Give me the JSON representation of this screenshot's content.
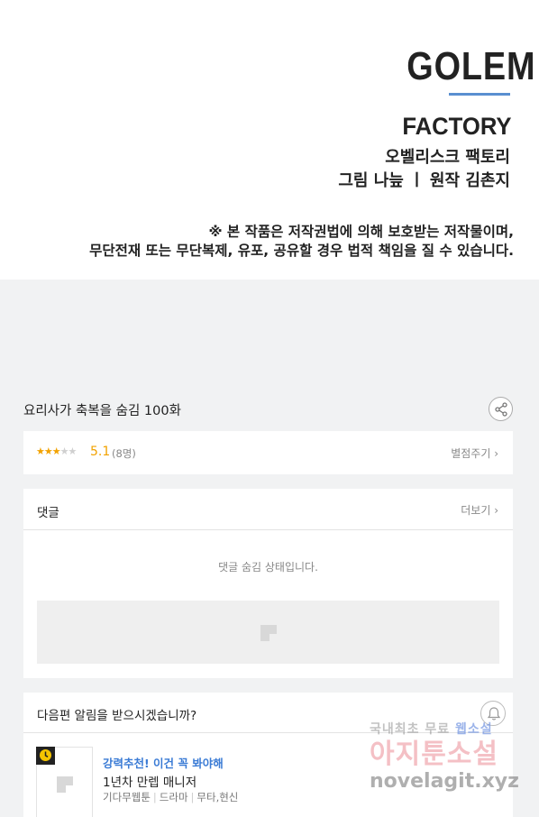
{
  "hero": {
    "logo_line1": "GOLEM",
    "logo_line2": "FACTORY",
    "credit_line1": "오벨리스크 팩토리",
    "credit_line2": "그림 나늪 ㅣ 원작 김촌지",
    "notice_line1": "※ 본 작품은 저작권법에 의해 보호받는 저작물이며,",
    "notice_line2": "무단전재 또는 무단복제, 유포, 공유할 경우 법적 책임을 질 수 있습니다."
  },
  "episode": {
    "title": "요리사가 축복을 숨김 100화",
    "share_icon": "share-icon"
  },
  "rating": {
    "stars_value": 2.5,
    "stars_max": 5,
    "score": "5.1",
    "voters": "(8명)",
    "rate_label": "별점주기 ›"
  },
  "comments": {
    "title": "댓글",
    "more_label": "더보기 ›",
    "hidden_message": "댓글 숨김 상태입니다."
  },
  "next_alert": {
    "question": "다음편 알림을 받으시겠습니까?",
    "bell_icon": "bell-icon"
  },
  "recommendation": {
    "tag": "강력추천! 이건 꼭 봐야해",
    "title": "1년차 만렙 매니저",
    "meta": [
      "기다무웹툰",
      "드라마",
      "무타,현신"
    ]
  },
  "watermark": {
    "line1_prefix": "국내최초 무료 ",
    "line1_highlight": "웹소설",
    "line2": "아지툰소설",
    "line3": "novelagit.xyz"
  },
  "colors": {
    "accent_star": "#f2a200",
    "link_blue": "#3a7bd5",
    "page_bg": "#f1f2f3"
  }
}
